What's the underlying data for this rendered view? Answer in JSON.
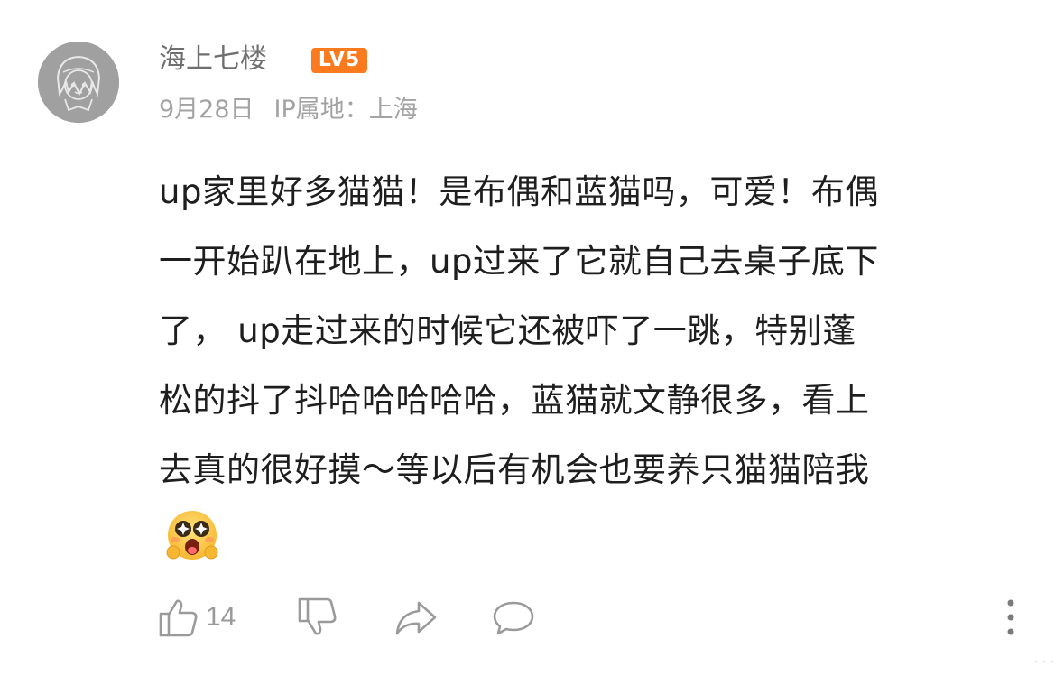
{
  "comment": {
    "author": {
      "name": "海上七楼",
      "level_badge": "LV5",
      "level_badge_color": "#fb7a1e",
      "avatar_icon": "anime-girl-sketch-avatar"
    },
    "date": "9月28日",
    "ip_location": "IP属地：上海",
    "lines": [
      "up家里好多猫猫！是布偶和蓝猫吗，可爱！布偶",
      "一开始趴在地上，up过来了它就自己去桌子底下",
      "了， up走过来的时候它还被吓了一跳，特别蓬",
      "松的抖了抖哈哈哈哈哈，蓝猫就文静很多，看上",
      "去真的很好摸～等以后有机会也要养只猫猫陪我"
    ],
    "emoji_icon": "starry-eyed-surprised-emoji",
    "actions": {
      "like_icon": "thumbs-up-icon",
      "like_count": "14",
      "dislike_icon": "thumbs-down-icon",
      "share_icon": "share-arrow-icon",
      "reply_icon": "comment-bubble-icon",
      "more_icon": "more-vertical-icon"
    }
  },
  "watermark": "···"
}
